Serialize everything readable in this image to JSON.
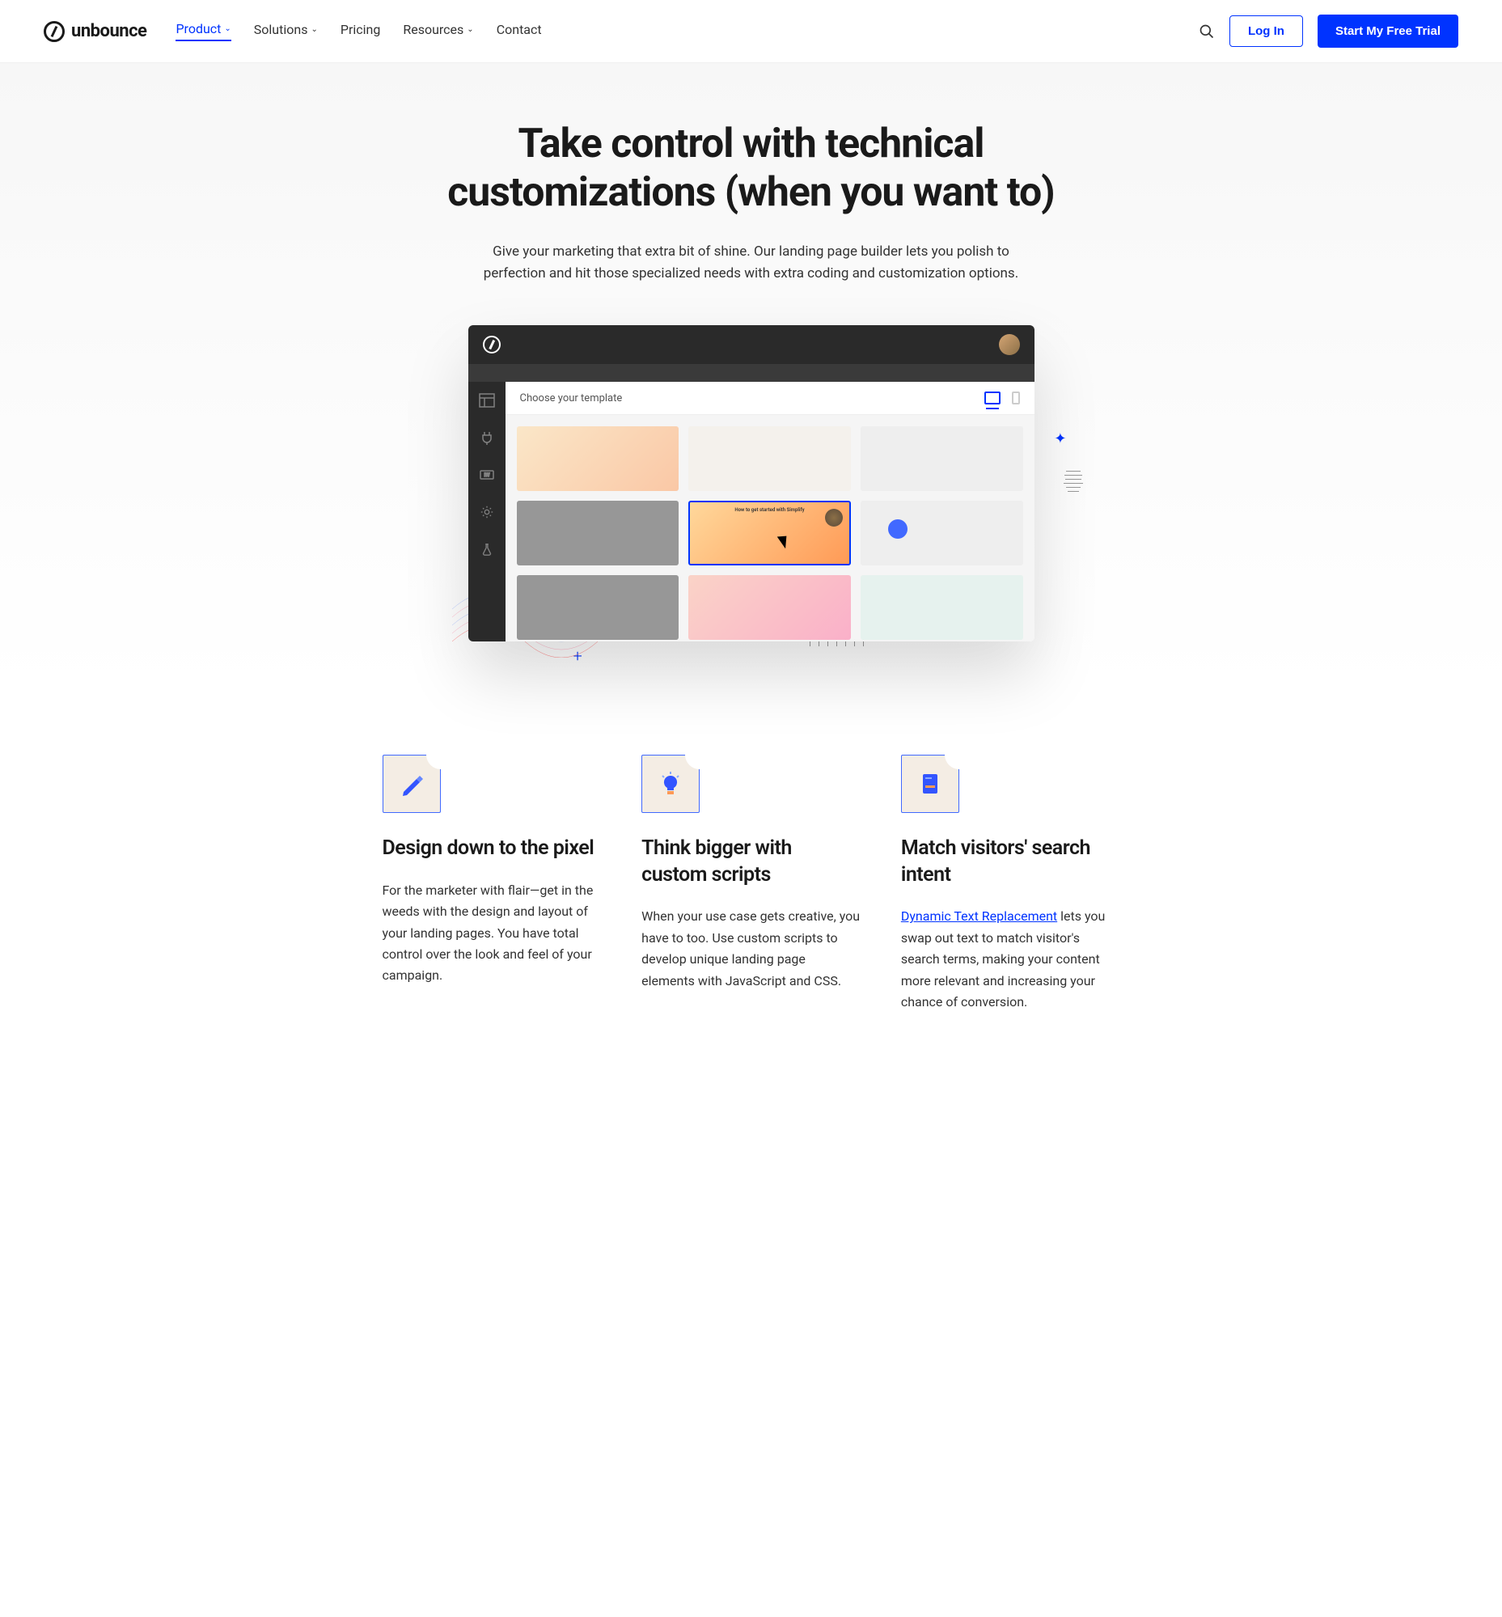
{
  "logo_text": "unbounce",
  "nav": {
    "items": [
      {
        "label": "Product",
        "active": true,
        "dropdown": true
      },
      {
        "label": "Solutions",
        "active": false,
        "dropdown": true
      },
      {
        "label": "Pricing",
        "active": false,
        "dropdown": false
      },
      {
        "label": "Resources",
        "active": false,
        "dropdown": true
      },
      {
        "label": "Contact",
        "active": false,
        "dropdown": false
      }
    ]
  },
  "header_cta": {
    "login": "Log In",
    "trial": "Start My Free Trial"
  },
  "hero": {
    "title": "Take control with technical customizations (when you want to)",
    "subtitle": "Give your marketing that extra bit of shine. Our landing page builder lets you polish to perfection and hit those specialized needs with extra coding and customization options."
  },
  "app": {
    "toolbar_label": "Choose your template",
    "selected_template_title": "How to get started with Simplify"
  },
  "features": [
    {
      "icon": "pencil-icon",
      "title": "Design down to the pixel",
      "body": "For the marketer with flair—get in the weeds with the design and layout of your landing pages. You have total control over the look and feel of your campaign."
    },
    {
      "icon": "lightbulb-icon",
      "title": "Think bigger with custom scripts",
      "body": "When your use case gets creative, you have to too. Use custom scripts to develop unique landing page elements with JavaScript and CSS."
    },
    {
      "icon": "document-icon",
      "title": "Match visitors' search intent",
      "link_text": "Dynamic Text Replacement",
      "body_after_link": " lets you swap out text to match visitor's search terms, making your content more relevant and increasing your chance of conversion."
    }
  ]
}
